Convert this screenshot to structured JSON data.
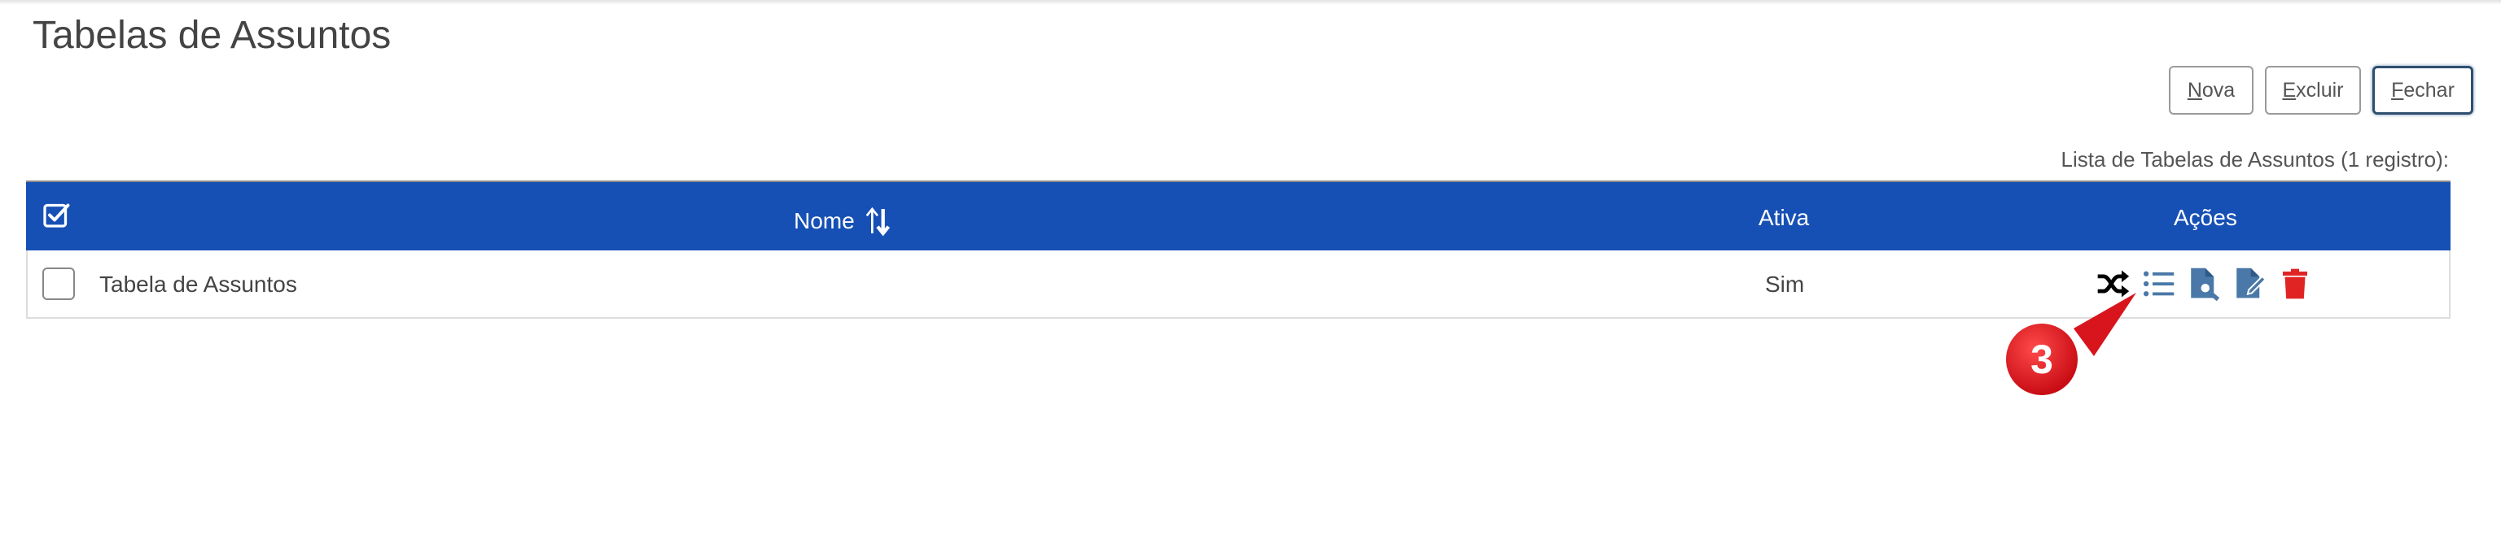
{
  "page": {
    "title": "Tabelas de Assuntos"
  },
  "toolbar": {
    "nova": {
      "first": "N",
      "rest": "ova"
    },
    "excluir": {
      "first": "E",
      "rest": "xcluir"
    },
    "fechar": {
      "first": "F",
      "rest": "echar"
    }
  },
  "list": {
    "count_label": "Lista de Tabelas de Assuntos (1 registro):"
  },
  "table": {
    "headers": {
      "nome": "Nome",
      "ativa": "Ativa",
      "acoes": "Ações"
    },
    "rows": [
      {
        "nome": "Tabela de Assuntos",
        "ativa": "Sim"
      }
    ],
    "actions": [
      "shuffle-icon",
      "list-icon",
      "document-search-icon",
      "document-edit-icon",
      "trash-icon"
    ]
  },
  "annotation": {
    "step": "3"
  },
  "colors": {
    "header_bg": "#1650b5",
    "action_blue": "#4a78a8",
    "delete_red": "#e02424",
    "callout_red": "#e0141e"
  }
}
